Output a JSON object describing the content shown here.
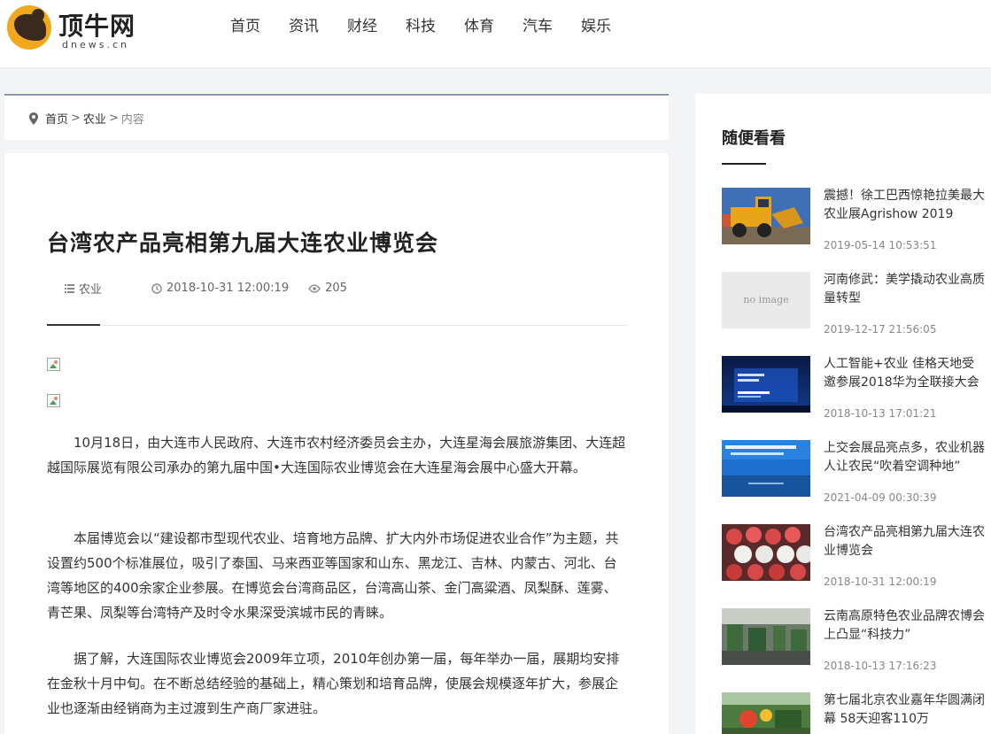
{
  "brand": {
    "name_cn": "顶牛网",
    "name_en": "dnews.cn"
  },
  "nav": [
    "首页",
    "资讯",
    "财经",
    "科技",
    "体育",
    "汽车",
    "娱乐"
  ],
  "breadcrumb": {
    "home": "首页",
    "sep1": ">",
    "category": "农业",
    "sep2": ">",
    "current": "内容"
  },
  "article": {
    "title": "台湾农产品亮相第九届大连农业博览会",
    "category": "农业",
    "datetime": "2018-10-31 12:00:19",
    "views": "205",
    "paragraphs": [
      "10月18日，由大连市人民政府、大连市农村经济委员会主办，大连星海会展旅游集团、大连超越国际展览有限公司承办的第九届中国•大连国际农业博览会在大连星海会展中心盛大开幕。",
      "本届博览会以“建设都市型现代农业、培育地方品牌、扩大内外市场促进农业合作”为主题，共设置约500个标准展位，吸引了泰国、马来西亚等国家和山东、黑龙江、吉林、内蒙古、河北、台湾等地区的400余家企业参展。在博览会台湾商品区，台湾高山茶、金门高粱酒、凤梨酥、莲雾、青芒果、凤梨等台湾特产及时令水果深受滨城市民的青睐。",
      "据了解，大连国际农业博览会2009年立项，2010年创办第一届，每年举办一届，展期均安排在金秋十月中旬。在不断总结经验的基础上，精心策划和培育品牌，使展会规模逐年扩大，参展企业也逐渐由经销商为主过渡到生产商厂家进驻。"
    ]
  },
  "sidebar": {
    "title": "随便看看",
    "no_image_label": "no image",
    "posts": [
      {
        "title": "震撼！徐工巴西惊艳拉美最大农业展Agrishow 2019",
        "date": "2019-05-14 10:53:51"
      },
      {
        "title": "河南修武：美学撬动农业高质量转型",
        "date": "2019-12-17 21:56:05"
      },
      {
        "title": "人工智能+农业 佳格天地受邀参展2018华为全联接大会",
        "date": "2018-10-13 17:01:21"
      },
      {
        "title": "上交会展品亮点多，农业机器人让农民“吹着空调种地”",
        "date": "2021-04-09 00:30:39"
      },
      {
        "title": "台湾农产品亮相第九届大连农业博览会",
        "date": "2018-10-31 12:00:19"
      },
      {
        "title": "云南高原特色农业品牌农博会上凸显“科技力”",
        "date": "2018-10-13 17:16:23"
      },
      {
        "title": "第七届北京农业嘉年华圆满闭幕 58天迎客110万",
        "date": ""
      }
    ]
  },
  "colors": {
    "accent": "#8d9aaa",
    "logo": "#f0a81c",
    "text": "#333333"
  }
}
